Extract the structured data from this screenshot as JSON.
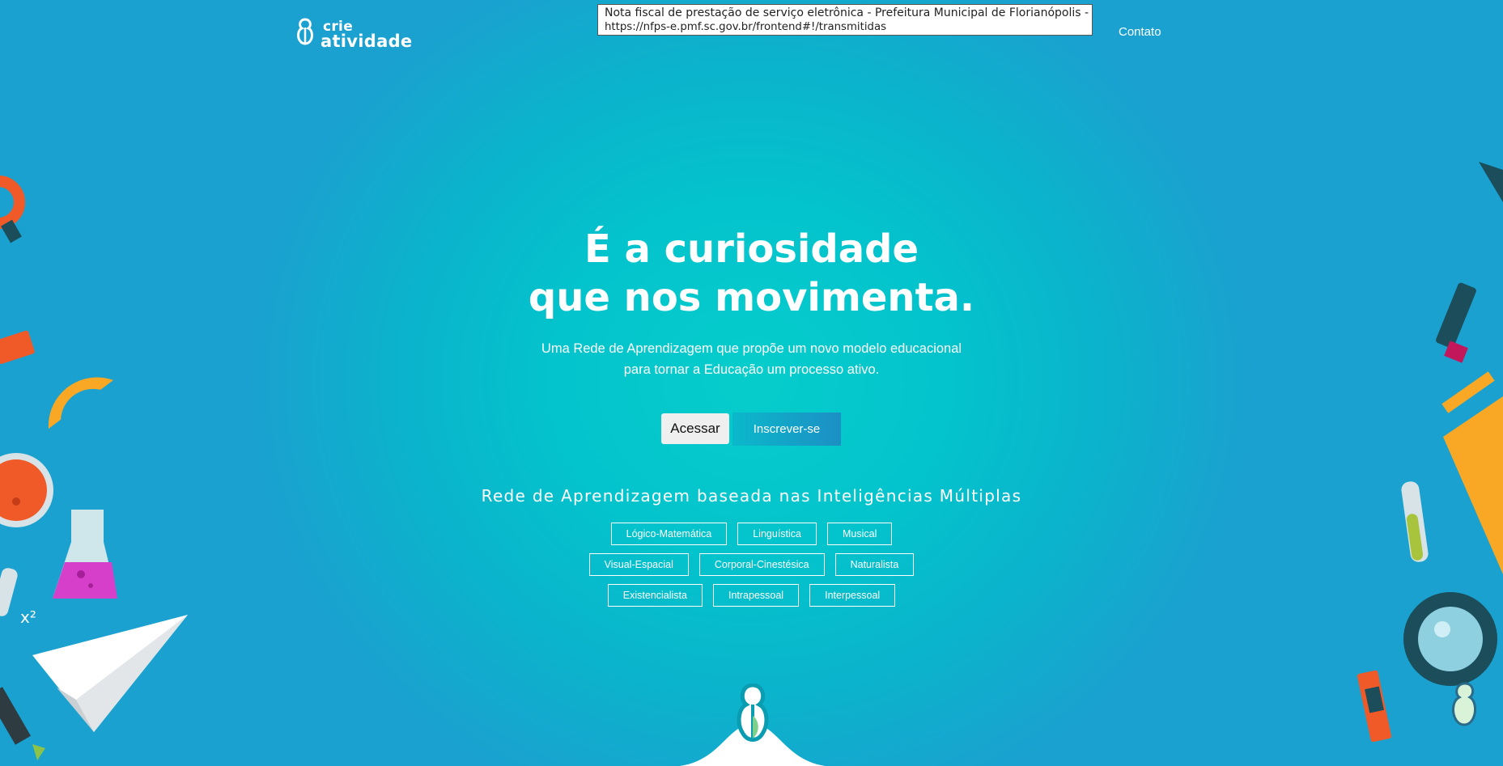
{
  "header": {
    "logo_line1": "crie",
    "logo_line2": "atividade",
    "nav_contact": "Contato"
  },
  "tooltip": {
    "title": "Nota fiscal de prestação de serviço eletrônica - Prefeitura Municipal de Florianópolis - SC",
    "url": "https://nfps-e.pmf.sc.gov.br/frontend#!/transmitidas"
  },
  "hero": {
    "headline_line1": "É a curiosidade",
    "headline_line2": "que nos movimenta.",
    "subtitle_line1": "Uma Rede de Aprendizagem que propõe um novo modelo educacional",
    "subtitle_line2": "para tornar a Educação um processo ativo.",
    "btn_login": "Acessar",
    "btn_signup": "Inscrever-se"
  },
  "intelligences": {
    "title": "Rede de Aprendizagem baseada nas Inteligências Múltiplas",
    "rows": [
      [
        "Lógico-Matemática",
        "Linguística",
        "Musical"
      ],
      [
        "Visual-Espacial",
        "Corporal-Cinestésica",
        "Naturalista"
      ],
      [
        "Existencialista",
        "Intrapessoal",
        "Interpessoal"
      ]
    ]
  },
  "decor": {
    "math_text": "x²"
  },
  "colors": {
    "background_center": "#06cdcc",
    "background_edge": "#1aa1cf",
    "signup_gradient_start": "#0bb8cb",
    "signup_gradient_end": "#1c8fc4"
  }
}
